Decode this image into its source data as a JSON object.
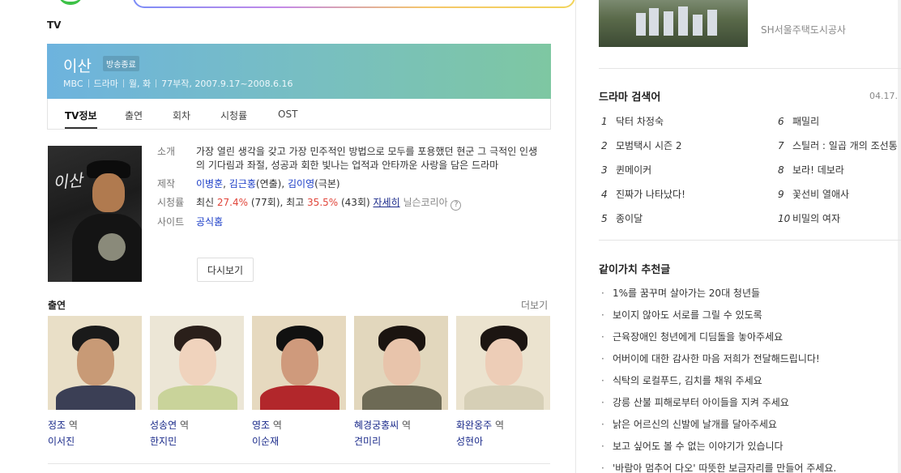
{
  "section_title": "TV",
  "drama": {
    "title": "이산",
    "status_badge": "방송종료",
    "broadcaster": "MBC",
    "genre": "드라마",
    "days": "월, 화",
    "episodes_period": "77부작, 2007.9.17~2008.6.16"
  },
  "tabs": [
    "TV정보",
    "출연",
    "회차",
    "시청률",
    "OST"
  ],
  "info": {
    "synopsis_label": "소개",
    "synopsis": "가장 열린 생각을 갖고 가장 민주적인 방법으로 모두를 포용했던 현군 그 극적인 인생의 기다림과 좌절, 성공과 회한 빛나는 업적과 안타까운 사랑을 담은 드라마",
    "production_label": "제작",
    "director1": "이병훈",
    "director2": "김근홍",
    "director_role": "(연출)",
    "writer": "김이영",
    "writer_role": "(극본)",
    "rating_label": "시청률",
    "rating_recent_prefix": "최신 ",
    "rating_recent": "27.4%",
    "rating_recent_ep": " (77회), 최고 ",
    "rating_max": "35.5%",
    "rating_max_ep": " (43회) ",
    "rating_detail_link": "자세히",
    "rating_source": "닐슨코리아",
    "site_label": "사이트",
    "site_link": "공식홈",
    "rewatch_button": "다시보기",
    "question_icon": "?"
  },
  "cast": {
    "title": "출연",
    "more": "더보기",
    "items": [
      {
        "role": "정조",
        "suffix": " 역",
        "actor": "이서진"
      },
      {
        "role": "성송연",
        "suffix": " 역",
        "actor": "한지민"
      },
      {
        "role": "영조",
        "suffix": " 역",
        "actor": "이순재"
      },
      {
        "role": "혜경궁홍씨",
        "suffix": " 역",
        "actor": "견미리"
      },
      {
        "role": "화완옹주",
        "suffix": " 역",
        "actor": "성현아"
      }
    ]
  },
  "right": {
    "thumb_caption": "SH서울주택도시공사",
    "keywords_title": "드라마 검색어",
    "keywords_date": "04.17.",
    "keywords": [
      {
        "n": "1",
        "text": "닥터 차정숙"
      },
      {
        "n": "2",
        "text": "모범택시 시즌 2"
      },
      {
        "n": "3",
        "text": "퀸메이커"
      },
      {
        "n": "4",
        "text": "진짜가 나타났다!"
      },
      {
        "n": "5",
        "text": "종이달"
      },
      {
        "n": "6",
        "text": "패밀리"
      },
      {
        "n": "7",
        "text": "스틸러 : 일곱 개의 조선통"
      },
      {
        "n": "8",
        "text": "보라! 데보라"
      },
      {
        "n": "9",
        "text": "꽃선비 열애사"
      },
      {
        "n": "10",
        "text": "비밀의 여자"
      }
    ],
    "recommend_title": "같이가치 추천글",
    "recommend": [
      "1%를 꿈꾸며 살아가는 20대 청년들",
      "보이지 않아도 서로를 그릴 수 있도록",
      "근육장애인 청년에게 디딤돌을 놓아주세요",
      "어버이에 대한 감사한 마음 저희가 전달해드립니다!",
      "식탁의 로컬푸드, 김치를 채워 주세요",
      "강릉 산불 피해로부터 아이들을 지켜 주세요",
      "낡은 어르신의 신발에 날개를 달아주세요",
      "보고 싶어도 볼 수 없는 이야기가 있습니다",
      "'바람아 멈추어 다오' 따뜻한 보금자리를 만들어 주세요."
    ],
    "bullet": "·"
  }
}
